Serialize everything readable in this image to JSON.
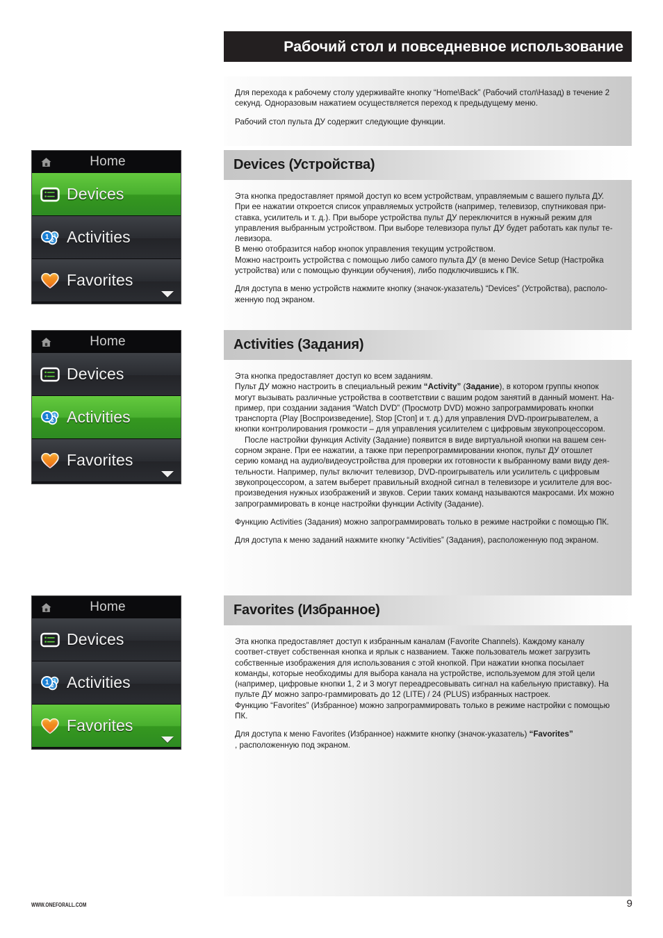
{
  "page": {
    "title": "Рабочий стол и повседневное использование",
    "number": "9",
    "footer_url": "WWW.ONEFORALL.COM"
  },
  "colors": {
    "title_bar": "#231f20",
    "accent_green_top": "#64c93e",
    "accent_green_bottom": "#2e8b22",
    "screen_dark": "#2a2c31",
    "screen_titlebar": "#0b0b0d",
    "heart_icon": "#f0821e",
    "activities_icon": "#1a7fd4"
  },
  "intro": {
    "paragraphs": [
      "Для перехода к рабочему столу удерживайте кнопку “Home\\Back” (Рабочий стол\\Назад) в течение 2 секунд. Одноразовым нажатием осуществляется переход к предыдущему меню.",
      "Рабочий стол пульта ДУ содержит следующие функции."
    ]
  },
  "mockups": [
    {
      "name": "devices-highlighted",
      "titlebar": {
        "icon": "home-icon",
        "label": "Home"
      },
      "rows": [
        {
          "icon": "devices-icon",
          "label": "Devices",
          "state": "active"
        },
        {
          "icon": "activities-icon",
          "label": "Activities",
          "state": "dim"
        },
        {
          "icon": "favorites-icon",
          "label": "Favorites",
          "state": "dim"
        }
      ],
      "scroll_indicator": "chevron-down-icon"
    },
    {
      "name": "activities-highlighted",
      "titlebar": {
        "icon": "home-icon",
        "label": "Home"
      },
      "rows": [
        {
          "icon": "devices-icon",
          "label": "Devices",
          "state": "dim"
        },
        {
          "icon": "activities-icon",
          "label": "Activities",
          "state": "active"
        },
        {
          "icon": "favorites-icon",
          "label": "Favorites",
          "state": "dim"
        }
      ],
      "scroll_indicator": "chevron-down-icon"
    },
    {
      "name": "favorites-highlighted",
      "titlebar": {
        "icon": "home-icon",
        "label": "Home"
      },
      "rows": [
        {
          "icon": "devices-icon",
          "label": "Devices",
          "state": "dim"
        },
        {
          "icon": "activities-icon",
          "label": "Activities",
          "state": "dim"
        },
        {
          "icon": "favorites-icon",
          "label": "Favorites",
          "state": "active"
        }
      ],
      "scroll_indicator": "chevron-down-icon"
    }
  ],
  "sections": {
    "devices": {
      "heading": "Devices (Устройства)",
      "p1": "Эта кнопка предоставляет прямой доступ ко всем устройствам, управляемым с вашего пульта ДУ. При ее нажатии откроется список управляемых устройств (например, телевизор, спутниковая при-ставка, усилитель и т. д.). При выборе устройства пульт ДУ переключится в нужный режим для управления выбранным устройством. При выборе телевизора пульт ДУ будет работать как пульт те-левизора.",
      "p2": "В меню отобразится набор кнопок управления текущим устройством.",
      "p3": "Можно настроить устройства с помощью либо самого пульта ДУ (в меню Device Setup (Настройка устройства) или с помощью функции обучения), либо подключившись к ПК.",
      "p4": "Для доступа в меню устройств нажмите кнопку (значок-указатель) “Devices” (Устройства), располо-женную под экраном."
    },
    "activities": {
      "heading": "Activities (Задания)",
      "p1": "Эта кнопка предоставляет доступ ко всем заданиям.",
      "p2_a": "Пульт ДУ можно настроить в специальный режим ",
      "p2_bold1": "“Activity”",
      "p2_b": " (",
      "p2_bold2": "Задание",
      "p2_c": "), в котором группы кнопок могут вызывать различные устройства в соответствии с вашим родом занятий в данный момент. На-пример, при создании задания “Watch DVD” (Просмотр DVD) можно запрограммировать кнопки транспорта (Play [Воспроизведение], Stop [Стоп] и т. д.) для управления DVD-проигрывателем, а кнопки контролирования громкости – для управления усилителем с цифровым звукопроцессором.",
      "p3": "После настройки функция Activity (Задание) появится в виде виртуальной кнопки на вашем сен-сорном экране. При ее нажатии, а также при перепрограммировании кнопок, пульт ДУ отошлет серию команд на аудио/видеоустройства для проверки их готовности к выбранному вами виду дея-тельности. Например, пульт включит телевизор, DVD-проигрыватель или усилитель с цифровым звукопроцессором, а затем выберет правильный входной сигнал в телевизоре и усилителе для вос-произведения нужных изображений и звуков. Серии таких команд называются макросами. Их можно запрограммировать в конце настройки функции Activity (Задание).",
      "p4": "Функцию Activities (Задания) можно запрограммировать только в режиме настройки с помощью ПК.",
      "p5": "Для доступа к меню заданий нажмите кнопку “Activities” (Задания), расположенную под экраном."
    },
    "favorites": {
      "heading": "Favorites (Избранное)",
      "p1": "Эта кнопка предоставляет доступ к избранным каналам (Favorite Channels). Каждому каналу соответ-ствует собственная кнопка и ярлык с названием. Также пользователь может загрузить собственные изображения для использования с этой кнопкой. При нажатии кнопка посылает команды, которые необходимы для выбора канала на устройстве, используемом для этой цели (например, цифровые кнопки 1, 2 и 3 могут переадресовывать сигнал на кабельную приставку). На пульте ДУ можно запро-граммировать до 12 (LITE) / 24 (PLUS) избранных настроек.",
      "p2": "Функцию “Favorites” (Избранное) можно запрограммировать только в режиме настройки с помощью ПК.",
      "p3_a": "Для доступа к меню Favorites (Избранное) нажмите кнопку (значок-указатель) ",
      "p3_bold": "“Favorites”",
      "p3_b": ", расположенную под экраном."
    }
  }
}
